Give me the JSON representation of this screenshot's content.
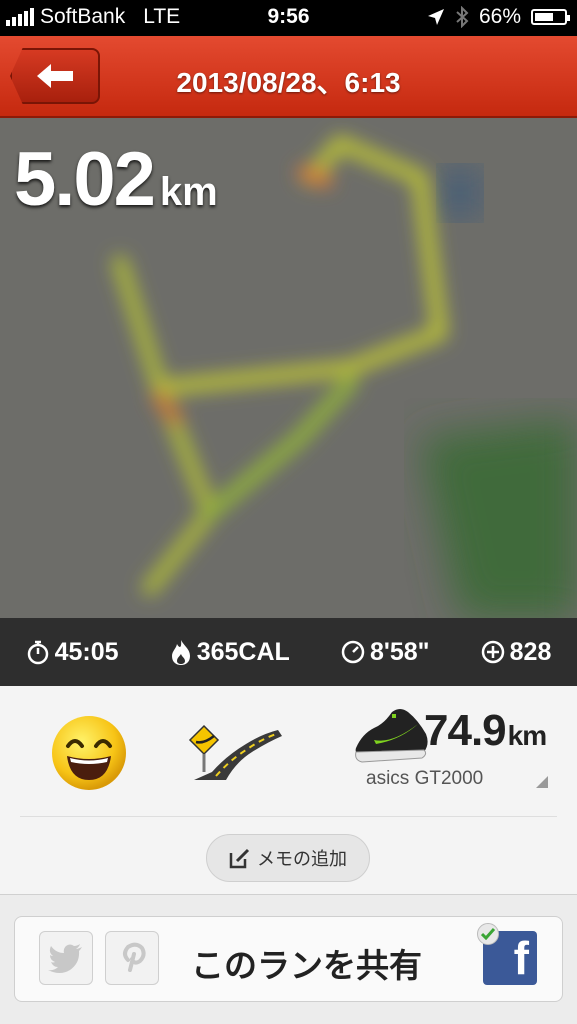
{
  "status_bar": {
    "carrier": "SoftBank",
    "network": "LTE",
    "time": "9:56",
    "battery_percent": "66%",
    "battery_level": 0.66
  },
  "header": {
    "title": "2013/08/28、6:13"
  },
  "map": {
    "distance_value": "5.02",
    "distance_unit": "km"
  },
  "stats": {
    "duration": "45:05",
    "calories": "365CAL",
    "pace": "8'58\"",
    "fuel": "828"
  },
  "run_details": {
    "mood_icon": "smiley-face-icon",
    "terrain_icon": "road-terrain-icon",
    "shoe_distance_value": "74.9",
    "shoe_distance_unit": "km",
    "shoe_name": "asics GT2000",
    "memo_label": "メモの追加"
  },
  "share": {
    "label": "このランを共有",
    "facebook_letter": "f"
  },
  "colors": {
    "header_red": "#d8391f",
    "stats_bar": "#2e2e2e",
    "facebook_blue": "#3b5998"
  }
}
